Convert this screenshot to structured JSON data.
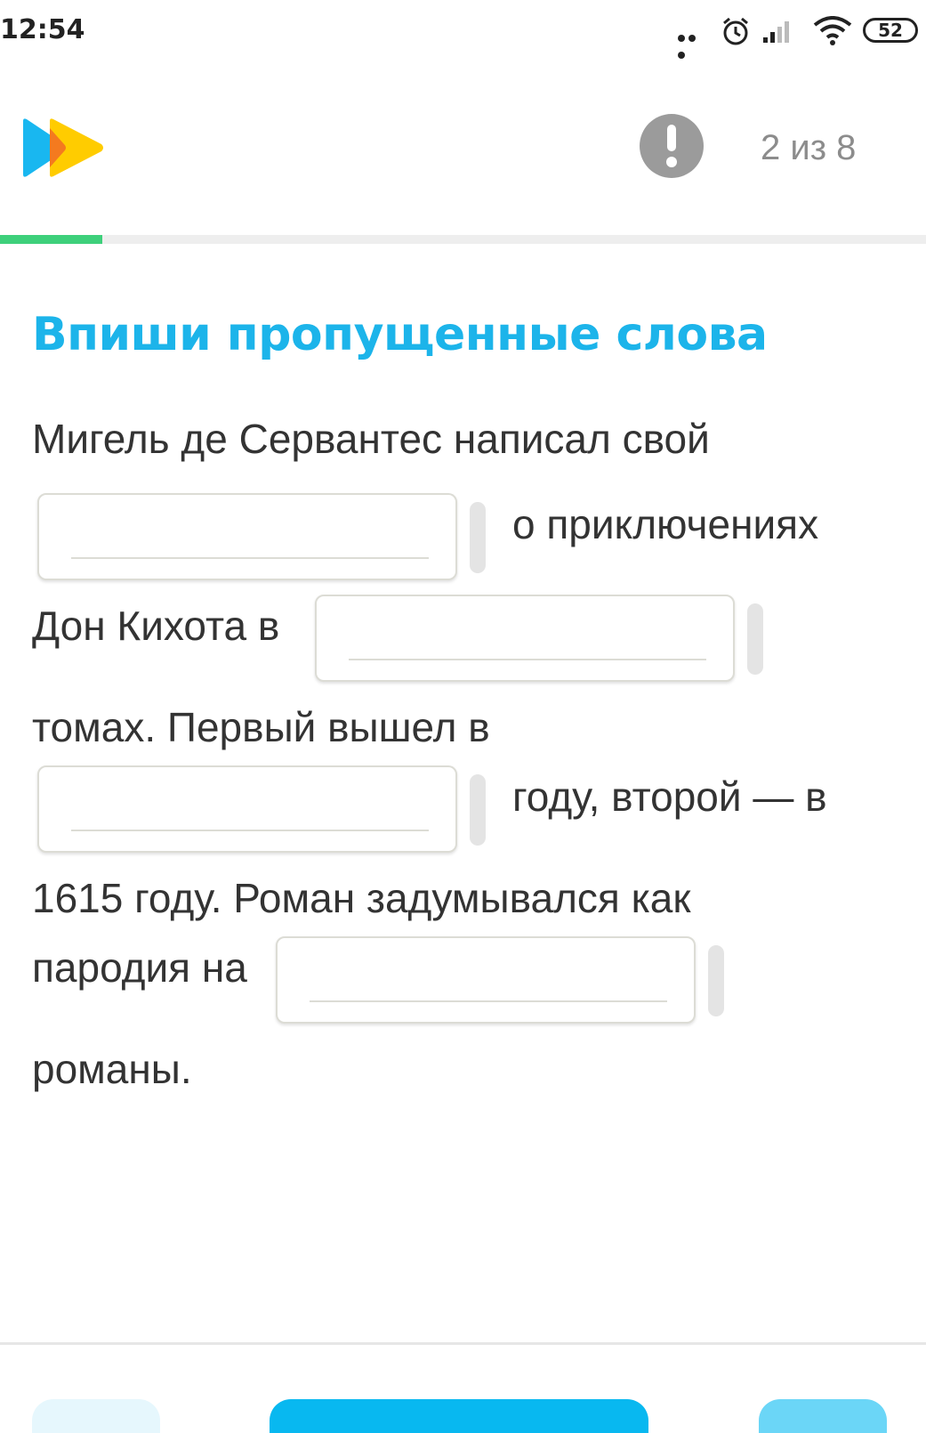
{
  "status_bar": {
    "time": "12:54",
    "battery": "52"
  },
  "header": {
    "counter": "2 из 8",
    "progress_fraction": 0.11
  },
  "exercise": {
    "title": "Впиши пропущенные слова",
    "segments": [
      "Мигель де Сервантес написал свой",
      "о приключениях",
      "Дон Кихота в",
      "томах. Первый вышел в",
      "году, второй — в",
      "1615 году. Роман задумывался как",
      "пародия на",
      "романы."
    ],
    "blanks": [
      "",
      "",
      "",
      ""
    ]
  },
  "colors": {
    "accent": "#1cb4ea",
    "progress": "#3ed07b",
    "primary_button": "#08b8f0"
  }
}
